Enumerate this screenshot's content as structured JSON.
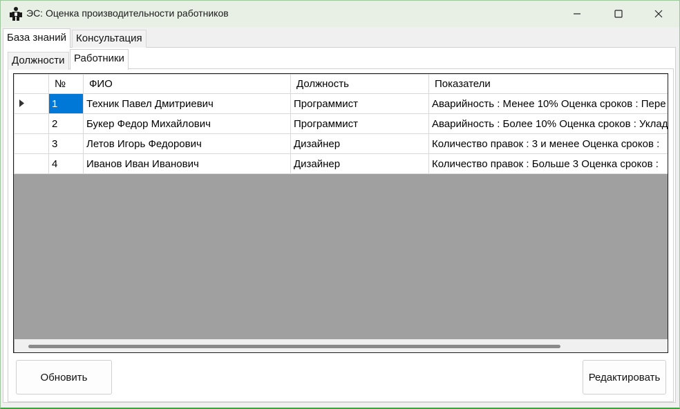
{
  "window": {
    "title": "ЭС: Оценка производительности работников",
    "icon": "app-logo-icon",
    "controls": [
      "minimize-icon",
      "maximize-icon",
      "close-icon"
    ]
  },
  "outer_tabs": [
    {
      "label": "База знаний",
      "active": true
    },
    {
      "label": "Консультация",
      "active": false
    }
  ],
  "inner_tabs": [
    {
      "label": "Должности",
      "active": false
    },
    {
      "label": "Работники",
      "active": true
    }
  ],
  "grid": {
    "columns": [
      "№",
      "ФИО",
      "Должность",
      "Показатели"
    ],
    "rows": [
      {
        "num": "1",
        "fio": "Техник Павел Дмитриевич",
        "position": "Программист",
        "indicators": "Аварийность : Менее 10%   Оценка сроков : Пере",
        "current": true
      },
      {
        "num": "2",
        "fio": "Букер Федор Михайлович",
        "position": "Программист",
        "indicators": "Аварийность : Более 10%   Оценка сроков : Уклад",
        "current": false
      },
      {
        "num": "3",
        "fio": "Летов Игорь Федорович",
        "position": "Дизайнер",
        "indicators": "Количество правок : 3 и менее   Оценка сроков :",
        "current": false
      },
      {
        "num": "4",
        "fio": "Иванов Иван Иванович",
        "position": "Дизайнер",
        "indicators": "Количество правок : Больше 3   Оценка сроков :",
        "current": false
      }
    ]
  },
  "buttons": {
    "refresh": "Обновить",
    "edit": "Редактировать"
  },
  "colors": {
    "selection": "#0078d7",
    "grid_background": "#a0a0a0",
    "titlebar": "#e8f0e6"
  }
}
